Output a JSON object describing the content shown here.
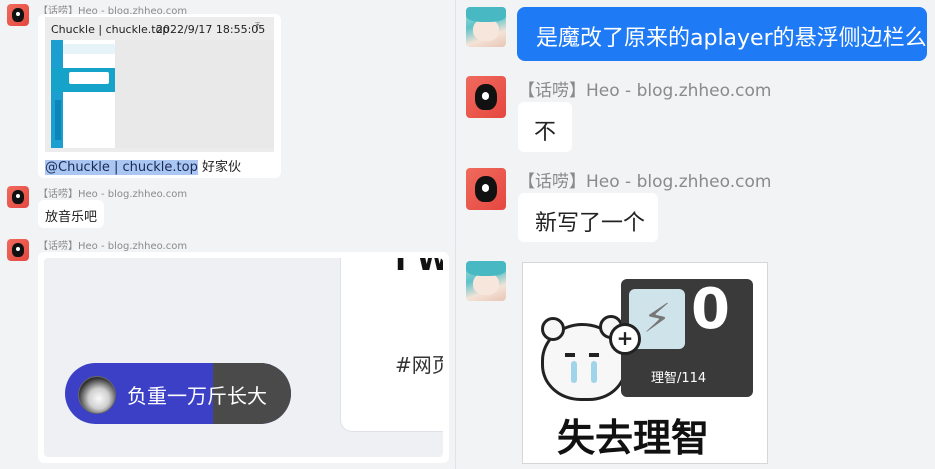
{
  "sender_name": "【话唠】Heo - blog.zhheo.com",
  "left_chat": {
    "quote": {
      "author": "Chuckle | chuckle.top",
      "time": "2022/9/17 18:55:05",
      "mention": "@Chuckle | chuckle.top",
      "reply_text": "好家伙"
    },
    "msg2_text": "放音乐吧",
    "player": {
      "song": "负重一万斤长大",
      "tag": "#网页",
      "top_fragment": "I W"
    }
  },
  "right_chat": {
    "my_message": "是魔改了原来的aplayer的悬浮侧边栏么",
    "reply1": "不",
    "reply2": "新写了一个",
    "sticker": {
      "caption": "失去理智",
      "stat_label": "理智/114",
      "stat_value": "0"
    }
  },
  "colors": {
    "self_bubble": "#1e7af5",
    "highlight": "#a9c7f2",
    "player_pill": "#3b40c6",
    "player_dark": "#4a4a4a"
  }
}
